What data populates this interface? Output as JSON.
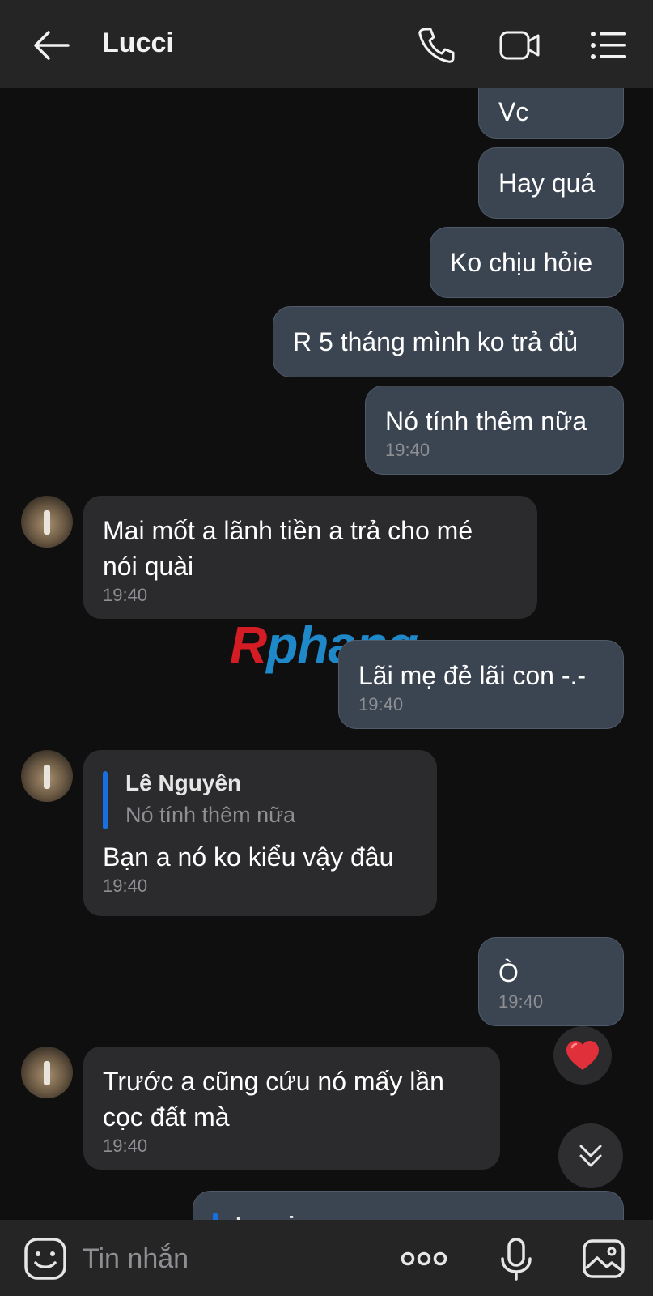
{
  "header": {
    "title": "Lucci"
  },
  "messages": [
    {
      "text": "Vc"
    },
    {
      "text": "Hay quá"
    },
    {
      "text": "Ko chịu hỏie"
    },
    {
      "text": "R 5 tháng mình ko trả đủ"
    },
    {
      "text": "Nó tính thêm nữa",
      "time": "19:40"
    },
    {
      "text": "Mai mốt a lãnh tiền a trả cho mé\nnói quài",
      "time": "19:40"
    },
    {
      "text": "Lãi mẹ đẻ lãi con -.-",
      "time": "19:40"
    },
    {
      "text": "Bạn a nó ko kiểu vậy đâu",
      "time": "19:40",
      "reply": {
        "name": "Lê Nguyên",
        "text": "Nó tính thêm nữa"
      }
    },
    {
      "text": "Ò",
      "time": "19:40"
    },
    {
      "text": "Trước a cũng cứu nó mấy lần\ncọc đất mà",
      "time": "19:40"
    },
    {
      "reply": {
        "name": "Lucci"
      }
    }
  ],
  "watermark": {
    "r": "R",
    "rest": "phang"
  },
  "reaction": {
    "icon": "heart-icon",
    "color": "#e0303a"
  },
  "composer": {
    "placeholder": "Tin nhắn"
  },
  "colors": {
    "background": "#0f0f10",
    "bar": "#252526",
    "outgoing_bubble": "#3b4451",
    "incoming_bubble": "#2b2b2d",
    "reply_accent": "#1a6fe0"
  }
}
